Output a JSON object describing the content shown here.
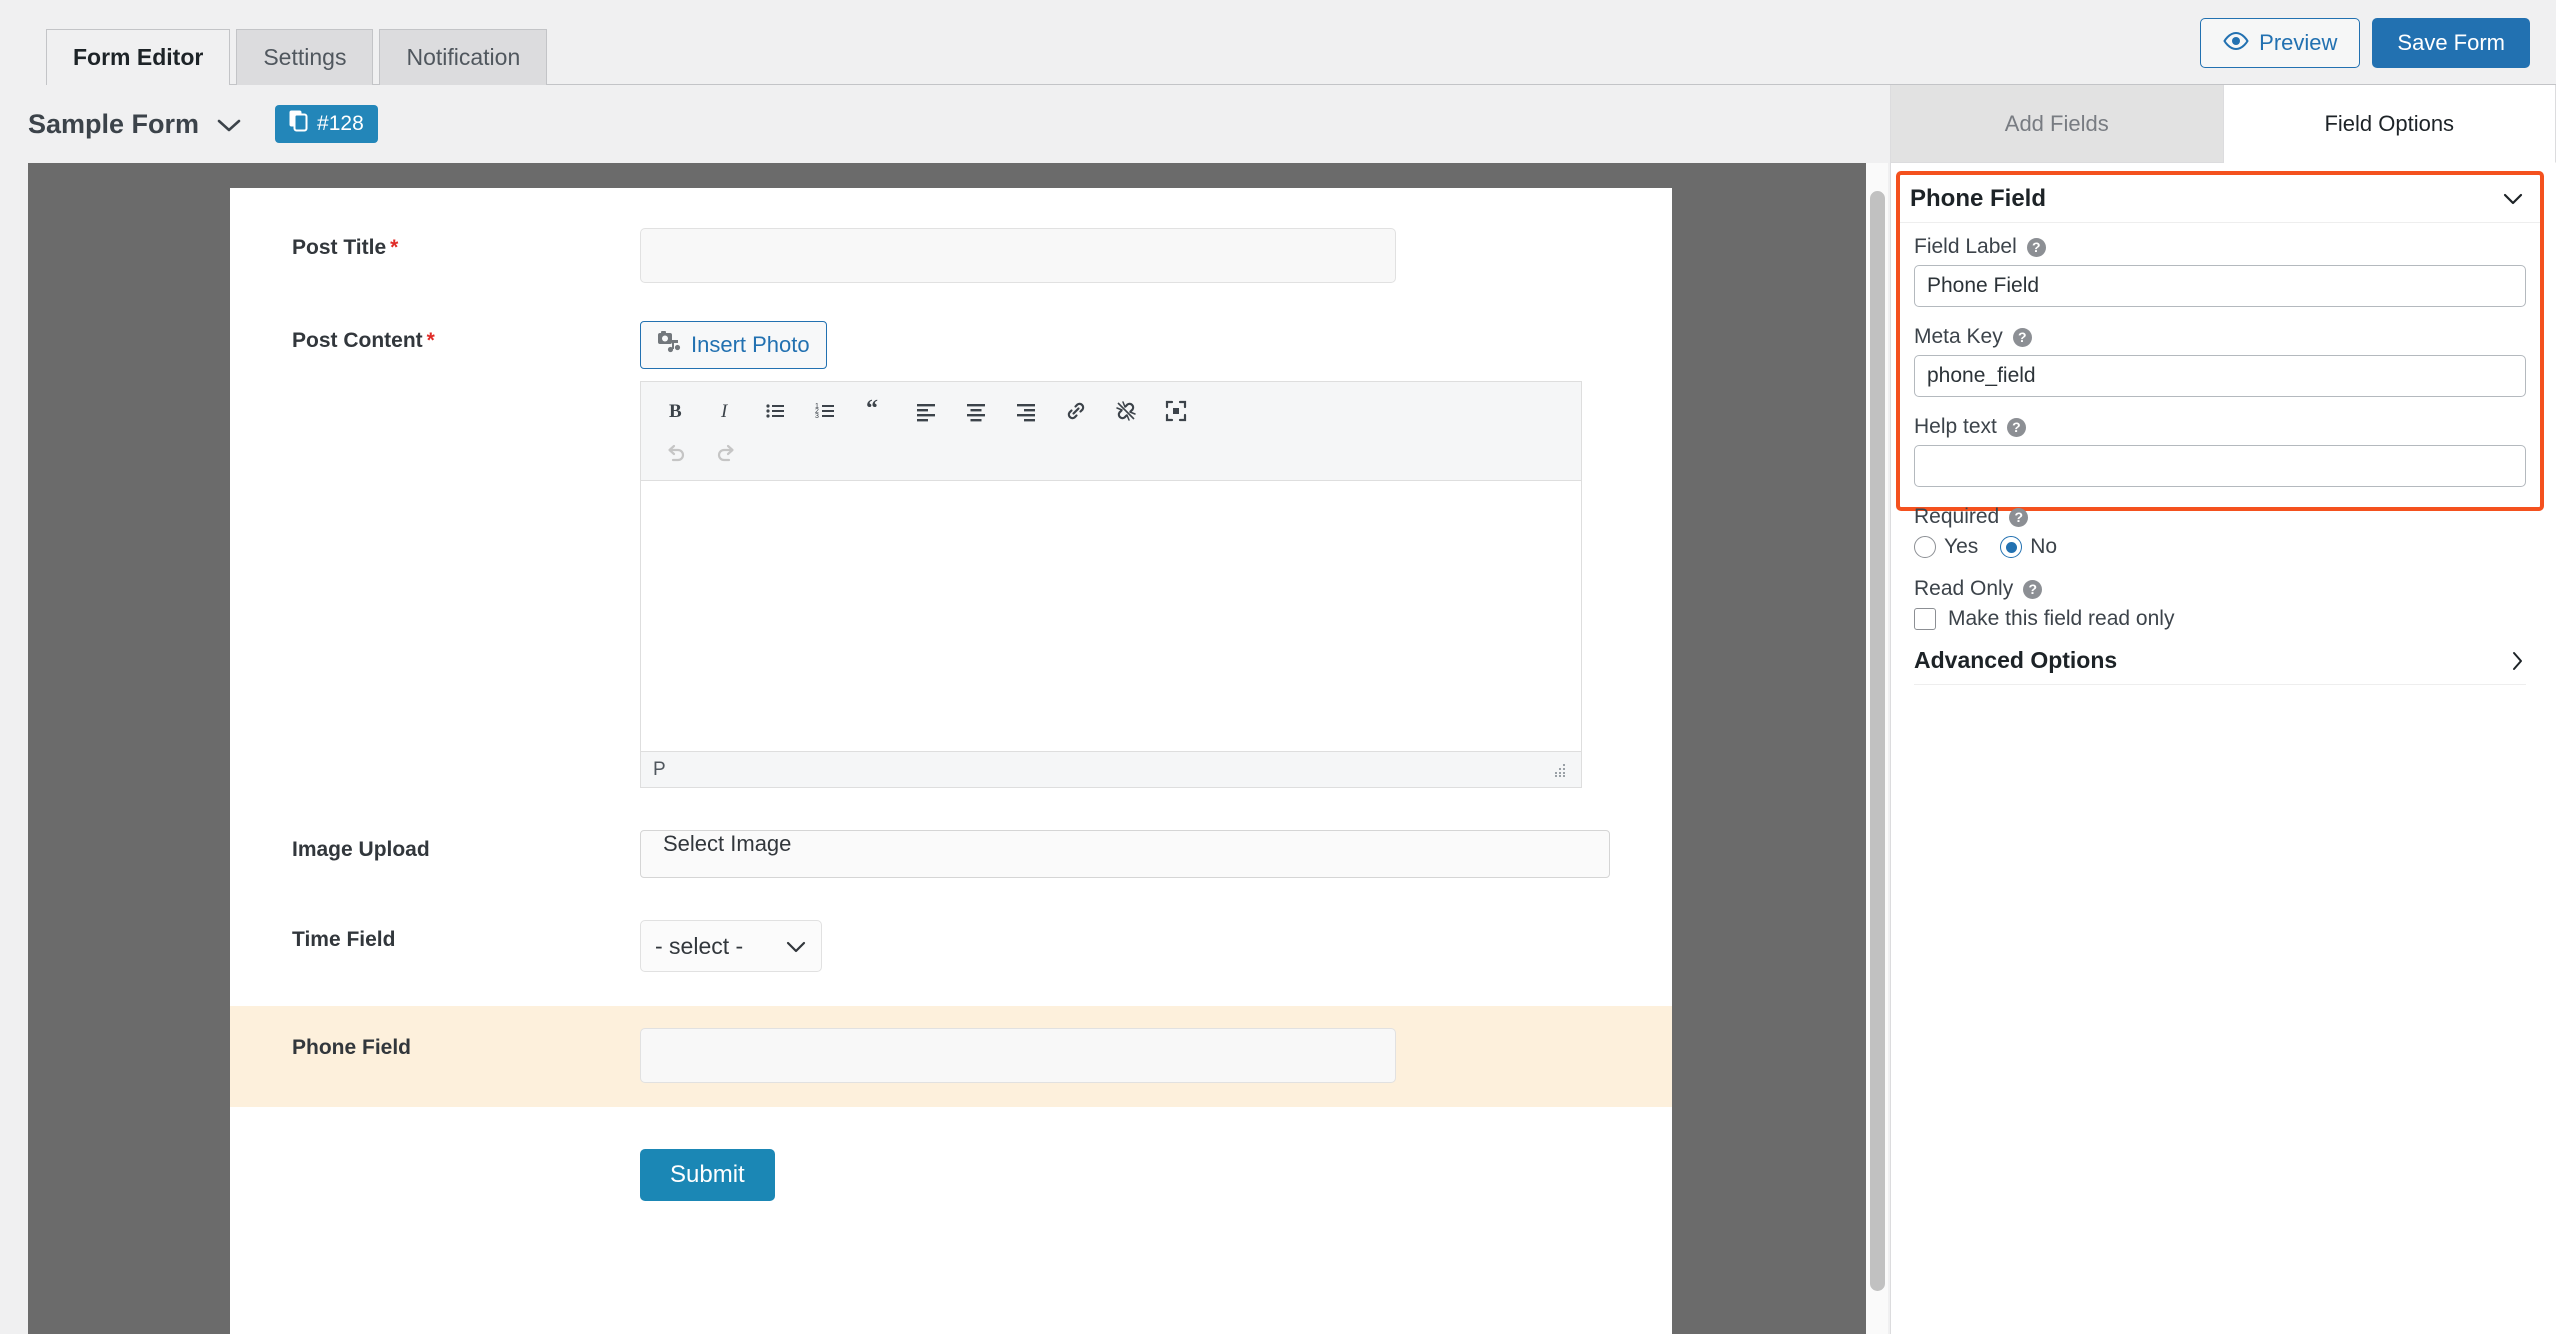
{
  "topbar": {
    "tabs": [
      {
        "label": "Form Editor",
        "active": true
      },
      {
        "label": "Settings",
        "active": false
      },
      {
        "label": "Notification",
        "active": false
      }
    ],
    "preview_label": "Preview",
    "save_label": "Save Form",
    "preview_icon": "eye-icon",
    "accent_blue": "#2271b1"
  },
  "formbar": {
    "form_title": "Sample Form",
    "caret_icon": "chevron-down-icon",
    "badge_icon": "copy-icon",
    "badge_label": "#128",
    "badge_color": "#2386b9"
  },
  "panel_tabs": [
    {
      "label": "Add Fields",
      "active": false
    },
    {
      "label": "Field Options",
      "active": true
    }
  ],
  "form_preview": {
    "rows": [
      {
        "label": "Post Title",
        "required": true,
        "control": "text-input"
      },
      {
        "label": "Post Content",
        "required": true,
        "control": "rich-editor"
      },
      {
        "label": "Image Upload",
        "required": false,
        "control": "select-image"
      },
      {
        "label": "Time Field",
        "required": false,
        "control": "select"
      },
      {
        "label": "Phone Field",
        "required": false,
        "control": "text-input",
        "highlight": true
      }
    ],
    "insert_photo_label": "Insert Photo",
    "insert_photo_icon": "media-camera-icon",
    "select_image_label": "Select Image",
    "time_select_value": "- select -",
    "time_select_icon": "chevron-down-icon",
    "submit_label": "Submit",
    "submit_color": "#1b87b5",
    "highlight_color": "#fdf0dc",
    "canvas_color": "#6b6b6b",
    "editor": {
      "status_text": "P",
      "toolbar_row1": [
        {
          "icon": "bold-icon",
          "label": "B"
        },
        {
          "icon": "italic-icon",
          "label": "I"
        },
        {
          "icon": "bulleted-list-icon",
          "label": ""
        },
        {
          "icon": "numbered-list-icon",
          "label": ""
        },
        {
          "icon": "blockquote-icon",
          "label": ""
        },
        {
          "icon": "align-left-icon",
          "label": ""
        },
        {
          "icon": "align-center-icon",
          "label": ""
        },
        {
          "icon": "align-right-icon",
          "label": ""
        },
        {
          "icon": "link-icon",
          "label": ""
        },
        {
          "icon": "unlink-icon",
          "label": ""
        },
        {
          "icon": "fullscreen-icon",
          "label": ""
        }
      ],
      "toolbar_row2": [
        {
          "icon": "undo-icon",
          "label": ""
        },
        {
          "icon": "redo-icon",
          "label": ""
        }
      ]
    }
  },
  "field_options": {
    "card_title": "Phone Field",
    "collapse_icon": "chevron-down-icon",
    "border_color": "#f4511e",
    "help_icon": "question-mark-icon",
    "field_label": {
      "label": "Field Label",
      "value": "Phone Field",
      "placeholder": ""
    },
    "meta_key": {
      "label": "Meta Key",
      "value": "phone_field",
      "placeholder": ""
    },
    "help_text": {
      "label": "Help text",
      "value": "",
      "placeholder": ""
    },
    "required": {
      "label": "Required",
      "options": [
        {
          "label": "Yes",
          "checked": false
        },
        {
          "label": "No",
          "checked": true
        }
      ]
    },
    "read_only": {
      "label": "Read Only",
      "checkbox_label": "Make this field read only",
      "checked": false
    },
    "advanced_options": {
      "label": "Advanced Options",
      "icon": "chevron-right-icon"
    }
  }
}
